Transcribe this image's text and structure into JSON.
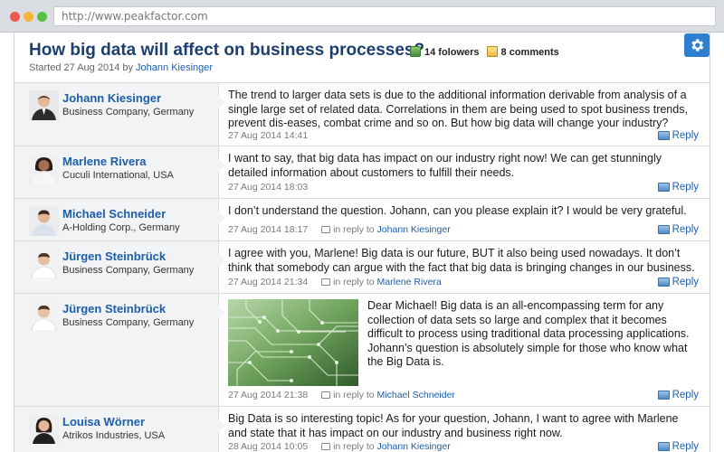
{
  "browser": {
    "url": "http://www.peakfactor.com"
  },
  "topic": {
    "title": "How big data will affect on business processes?",
    "followers": "14 folowers",
    "comments": "8 comments",
    "started_prefix": "Started 27 Aug 2014 by ",
    "started_author": "Johann Kiesinger"
  },
  "colors": {
    "accent": "#1d5ea8",
    "title": "#1d3f6e",
    "sidebar_bg": "#f1f3f5",
    "gear_bg": "#2f7fd1"
  },
  "posts": [
    {
      "author": "Johann Kiesinger",
      "company": "Business Company, Germany",
      "text": "The trend to larger data sets is due to the additional information derivable from analysis of a single large set of related data. Correlations in them are being used to spot business trends, prevent dis-eases, combat crime and so on. But how big data will change your industry?",
      "date": "27 Aug 2014 14:41",
      "in_reply_prefix": "",
      "in_reply_to": "",
      "reply_label": "Reply"
    },
    {
      "author": "Marlene Rivera",
      "company": "Cuculi International, USA",
      "text": "I want to say, that big data has impact on our industry right now! We can get stunningly detailed information about customers to fulfill their needs.",
      "date": "27 Aug 2014 18:03",
      "in_reply_prefix": "",
      "in_reply_to": "",
      "reply_label": "Reply"
    },
    {
      "author": "Michael Schneider",
      "company": "A-Holding Corp., Germany",
      "text": "I don’t understand the question. Johann, can you please explain it? I would be very grateful.",
      "date": "27 Aug 2014 18:17",
      "in_reply_prefix": "in reply to ",
      "in_reply_to": "Johann Kiesinger",
      "reply_label": "Reply"
    },
    {
      "author": "Jürgen Steinbrück",
      "company": "Business Company, Germany",
      "text": "I agree with you, Marlene! Big data is our future, BUT it also being used nowadays. It don’t think that somebody can argue with the fact that big data is bringing changes in our business.",
      "date": "27 Aug 2014 21:34",
      "in_reply_prefix": "in reply to ",
      "in_reply_to": "Marlene Rivera",
      "reply_label": "Reply"
    },
    {
      "author": "Jürgen Steinbrück",
      "company": "Business Company, Germany",
      "text": "Dear Michael! Big data is an all-encompassing term for any collection of data sets so large and complex that it becomes difficult to process using traditional data processing applications. Johann’s question is absolutely simple for those who know what the Big Data is.",
      "date": "27 Aug 2014 21:38",
      "in_reply_prefix": "in reply to ",
      "in_reply_to": "Michael Schneider",
      "reply_label": "Reply",
      "image": "circuit-board-photo"
    },
    {
      "author": "Louisa Wörner",
      "company": "Atrikos Industries, USA",
      "text": "Big Data is so interesting topic! As for your question, Johann, I want to agree with Marlene and state that it has impact on our industry and business right now.",
      "date": "28 Aug 2014 10:05",
      "in_reply_prefix": "in reply to ",
      "in_reply_to": "Johann Kiesinger",
      "reply_label": "Reply"
    }
  ]
}
